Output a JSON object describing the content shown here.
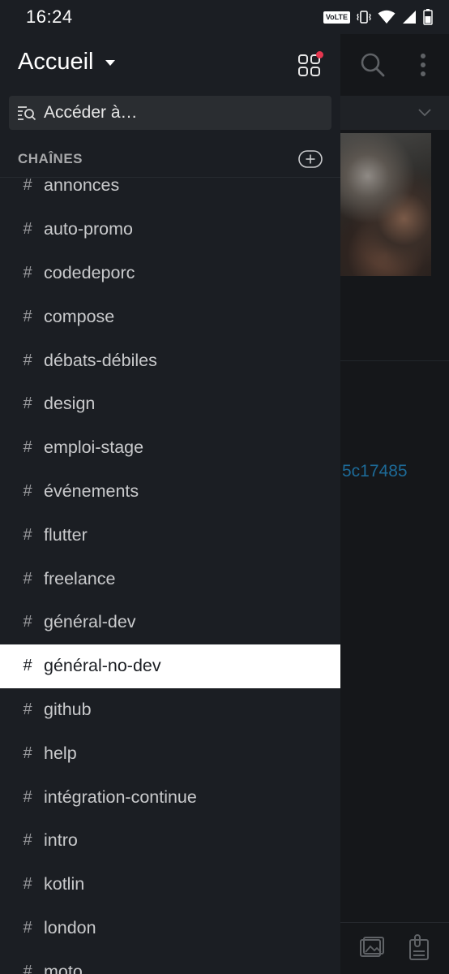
{
  "status_bar": {
    "time": "16:24",
    "volte_label": "VoLTE",
    "icons": [
      "volte-icon",
      "vibrate-icon",
      "wifi-icon",
      "signal-icon",
      "battery-icon"
    ]
  },
  "drawer": {
    "workspace_title": "Accueil",
    "jump_placeholder": "Accéder à…",
    "channels_section_title": "CHAÎNES",
    "channels": [
      {
        "name": "annonces",
        "active": false
      },
      {
        "name": "auto-promo",
        "active": false
      },
      {
        "name": "codedeporc",
        "active": false
      },
      {
        "name": "compose",
        "active": false
      },
      {
        "name": "débats-débiles",
        "active": false
      },
      {
        "name": "design",
        "active": false
      },
      {
        "name": "emploi-stage",
        "active": false
      },
      {
        "name": "événements",
        "active": false
      },
      {
        "name": "flutter",
        "active": false
      },
      {
        "name": "freelance",
        "active": false
      },
      {
        "name": "général-dev",
        "active": false
      },
      {
        "name": "général-no-dev",
        "active": true
      },
      {
        "name": "github",
        "active": false
      },
      {
        "name": "help",
        "active": false
      },
      {
        "name": "intégration-continue",
        "active": false
      },
      {
        "name": "intro",
        "active": false
      },
      {
        "name": "kotlin",
        "active": false
      },
      {
        "name": "london",
        "active": false
      },
      {
        "name": "moto",
        "active": false
      }
    ],
    "hash_symbol": "#"
  },
  "background": {
    "partial_link_text": "5c17485"
  },
  "colors": {
    "drawer_bg": "#1b1e23",
    "active_row_bg": "#ffffff",
    "notification_dot": "#e5364f",
    "link_blue": "#1d6a97"
  }
}
